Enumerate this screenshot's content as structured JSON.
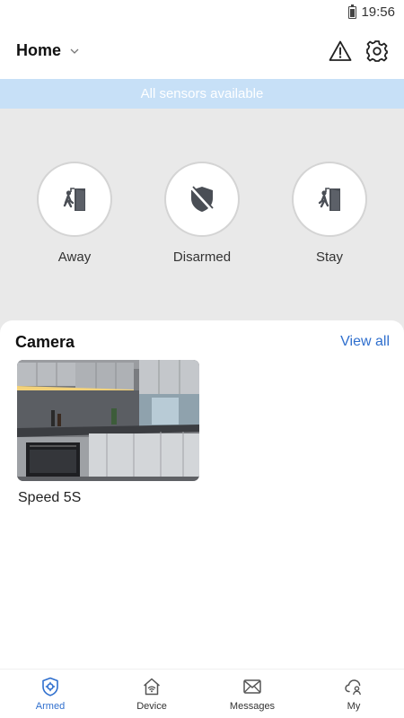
{
  "status_bar": {
    "time": "19:56",
    "battery_icon": "battery-icon"
  },
  "header": {
    "home_label": "Home",
    "chevron_icon": "chevron-down-icon",
    "alert_icon": "alert-triangle-icon",
    "settings_icon": "gear-icon"
  },
  "banner": {
    "text": "All sensors available",
    "color": "#c7e0f7"
  },
  "modes": [
    {
      "label": "Away",
      "icon": "person-exit-door-icon"
    },
    {
      "label": "Disarmed",
      "icon": "shield-off-icon"
    },
    {
      "label": "Stay",
      "icon": "person-enter-door-icon"
    }
  ],
  "camera": {
    "title": "Camera",
    "view_all": "View all",
    "items": [
      {
        "name": "Speed 5S",
        "thumbnail": "kitchen-camera-snapshot"
      }
    ]
  },
  "bottom_nav": {
    "accent_color": "#2f6fce",
    "items": [
      {
        "label": "Armed",
        "icon": "shield-gear-icon",
        "active": true
      },
      {
        "label": "Device",
        "icon": "home-wifi-icon",
        "active": false
      },
      {
        "label": "Messages",
        "icon": "envelope-icon",
        "active": false
      },
      {
        "label": "My",
        "icon": "cloud-user-icon",
        "active": false
      }
    ]
  }
}
